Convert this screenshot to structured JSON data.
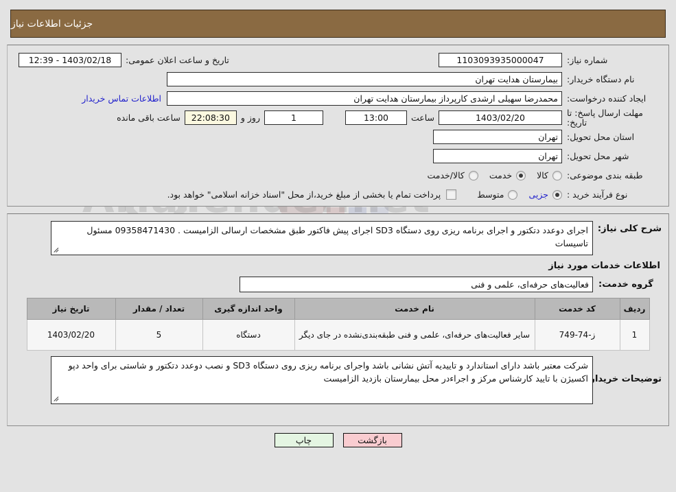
{
  "header": {
    "title": "جزئیات اطلاعات نیاز"
  },
  "watermark": {
    "text": "AriaTender.net"
  },
  "form": {
    "need_number": {
      "label": "شماره نیاز:",
      "value": "1103093935000047"
    },
    "public_announce": {
      "label": "تاریخ و ساعت اعلان عمومی:",
      "value": "1403/02/18 - 12:39"
    },
    "buyer_org": {
      "label": "نام دستگاه خریدار:",
      "value": "بیمارستان هدایت تهران"
    },
    "requester": {
      "label": "ایجاد کننده درخواست:",
      "value": "محمدرضا سهیلی ارشدی کارپرداز بیمارستان هدایت تهران",
      "contact_link": "اطلاعات تماس خریدار"
    },
    "deadline": {
      "label": "مهلت ارسال پاسخ: تا تاریخ:",
      "date": "1403/02/20",
      "time_label": "ساعت",
      "time": "13:00",
      "days": "1",
      "days_label": "روز و",
      "countdown": "22:08:30",
      "countdown_label": "ساعت باقی مانده"
    },
    "province": {
      "label": "استان محل تحویل:",
      "value": "تهران"
    },
    "city": {
      "label": "شهر محل تحویل:",
      "value": "تهران"
    },
    "category": {
      "label": "طبقه بندی موضوعی:",
      "options": [
        "کالا",
        "خدمت",
        "کالا/خدمت"
      ],
      "selected": "خدمت"
    },
    "process_type": {
      "label": "نوع فرآیند خرید :",
      "options": [
        "جزیی",
        "متوسط"
      ],
      "selected": "جزیی",
      "note": "پرداخت تمام یا بخشی از مبلغ خرید،از محل \"اسناد خزانه اسلامی\" خواهد بود.",
      "note_checked": false
    }
  },
  "details": {
    "summary_label": "شرح کلی نیاز:",
    "summary_value": "اجرای دوعدد دتکتور و اجرای برنامه ریزی روی دستگاه SD3 اجرای پیش فاکتور طبق مشخصات ارسالی الزامیست . 09358471430 مسئول تاسیسات",
    "services_section_title": "اطلاعات خدمات مورد نیاز",
    "service_group_label": "گروه خدمت:",
    "service_group_value": "فعالیت‌های حرفه‌ای، علمی و فنی",
    "buyer_notes_label": "توضیحات خریدار:",
    "buyer_notes_value": "شرکت معتبر باشد دارای استاندارد و تاییدیه آتش نشانی باشد واجرای برنامه ریزی روی دستگاه SD3  و نصب دوعدد دتکتور و شاستی برای واحد دپو اکسیژن با تایید کارشناس مرکز و اجراءدر محل بیمارستان بازدید الزامیست"
  },
  "table": {
    "columns": [
      "ردیف",
      "کد خدمت",
      "نام خدمت",
      "واحد اندازه گیری",
      "تعداد / مقدار",
      "تاریخ نیاز"
    ],
    "rows": [
      {
        "index": "1",
        "code": "ز-74-749",
        "name": "سایر فعالیت‌های حرفه‌ای، علمی و فنی طبقه‌بندی‌نشده در جای دیگر",
        "unit": "دستگاه",
        "qty": "5",
        "date": "1403/02/20"
      }
    ]
  },
  "footer": {
    "back_label": "بازگشت",
    "print_label": "چاپ"
  },
  "colors": {
    "header_bg": "#8a6a42",
    "page_bg": "#e3e3e3",
    "link": "#2222cc",
    "back_btn": "#f9ccd0",
    "print_btn": "#e4f5e2",
    "countdown_bg": "#fbf8e0"
  }
}
